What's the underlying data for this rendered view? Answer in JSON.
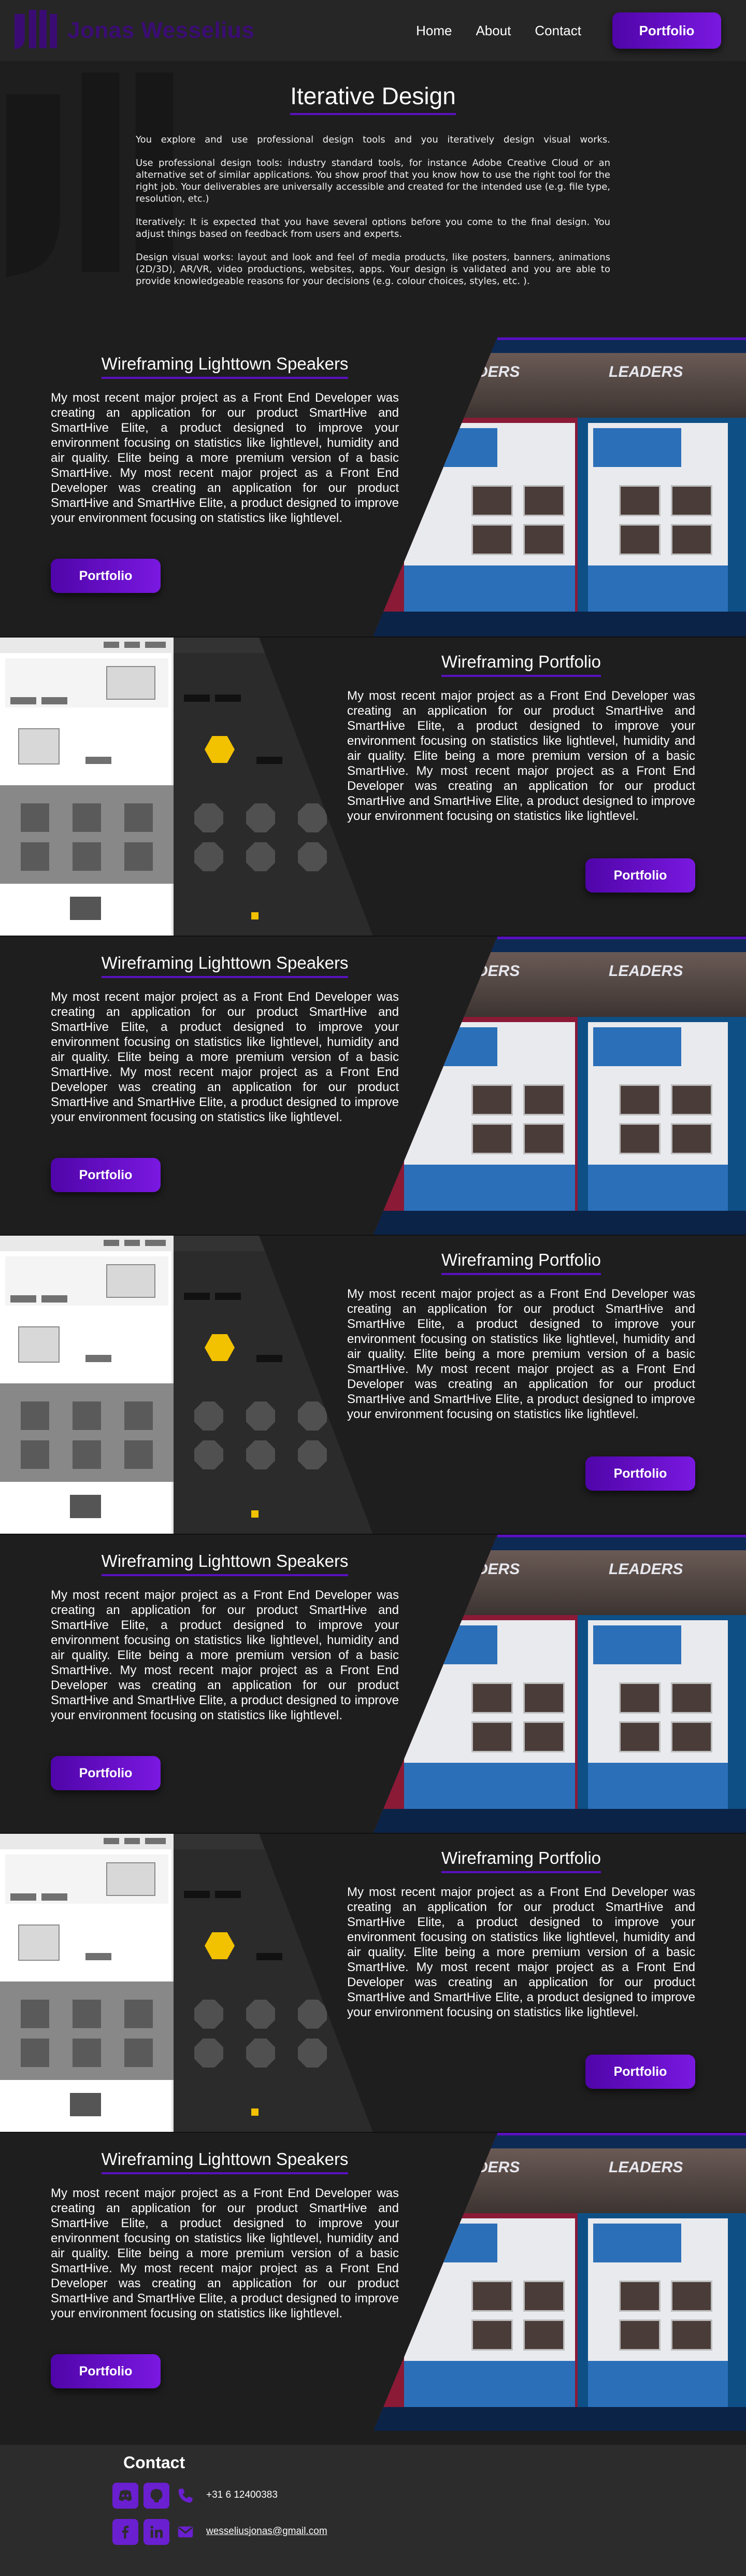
{
  "header": {
    "brand": "Jonas Wesselius",
    "nav": [
      {
        "label": "Home"
      },
      {
        "label": "About"
      },
      {
        "label": "Contact"
      }
    ],
    "cta": "Portfolio"
  },
  "intro": {
    "title": "Iterative Design",
    "paragraphs": [
      "You explore and use professional design tools and you iteratively design visual works.",
      "Use professional design tools: industry standard tools, for instance Adobe Creative Cloud or an alternative set of similar applications. You show proof that you know how to use the right tool for the right job. Your deliverables are universally accessible and created for the intended use (e.g. file type, resolution, etc.)",
      "Iteratively: It is expected that you have several options before you come to the final design. You adjust things based on feedback from users and experts.",
      "Design visual works: layout and look and feel of media products, like posters, banners, animations (2D/3D), AR/VR, video productions, websites, apps. Your design is validated and you are able to provide knowledgeable reasons for your decisions (e.g. colour choices, styles, etc. )."
    ]
  },
  "projects": [
    {
      "title": "Wireframing Lighttown Speakers",
      "body": "My most recent major project as a Front End Developer was creating an application for our product SmartHive and SmartHive Elite, a product designed to improve your environment focusing on statistics like lightlevel, humidity and air quality. Elite being a more premium version of a basic SmartHive. My most recent major project as a Front End Developer was creating an application for our product SmartHive and SmartHive Elite, a product designed to improve your environment focusing on statistics like lightlevel.",
      "button": "Portfolio",
      "mockup_heading": "LEADERS"
    },
    {
      "title": "Wireframing Portfolio",
      "body": "My most recent major project as a Front End Developer was creating an application for our product SmartHive and SmartHive Elite, a product designed to improve your environment focusing on statistics like lightlevel, humidity and air quality. Elite being a more premium version of a basic SmartHive. My most recent major project as a Front End Developer was creating an application for our product SmartHive and SmartHive Elite, a product designed to improve your environment focusing on statistics like lightlevel.",
      "button": "Portfolio"
    },
    {
      "title": "Wireframing Lighttown Speakers",
      "body": "My most recent major project as a Front End Developer was creating an application for our product SmartHive and SmartHive Elite, a product designed to improve your environment focusing on statistics like lightlevel, humidity and air quality. Elite being a more premium version of a basic SmartHive. My most recent major project as a Front End Developer was creating an application for our product SmartHive and SmartHive Elite, a product designed to improve your environment focusing on statistics like lightlevel.",
      "button": "Portfolio",
      "mockup_heading": "LEADERS"
    },
    {
      "title": "Wireframing Portfolio",
      "body": "My most recent major project as a Front End Developer was creating an application for our product SmartHive and SmartHive Elite, a product designed to improve your environment focusing on statistics like lightlevel, humidity and air quality. Elite being a more premium version of a basic SmartHive. My most recent major project as a Front End Developer was creating an application for our product SmartHive and SmartHive Elite, a product designed to improve your environment focusing on statistics like lightlevel.",
      "button": "Portfolio"
    },
    {
      "title": "Wireframing Lighttown Speakers",
      "body": "My most recent major project as a Front End Developer was creating an application for our product SmartHive and SmartHive Elite, a product designed to improve your environment focusing on statistics like lightlevel, humidity and air quality. Elite being a more premium version of a basic SmartHive. My most recent major project as a Front End Developer was creating an application for our product SmartHive and SmartHive Elite, a product designed to improve your environment focusing on statistics like lightlevel.",
      "button": "Portfolio",
      "mockup_heading": "LEADERS"
    },
    {
      "title": "Wireframing Portfolio",
      "body": "My most recent major project as a Front End Developer was creating an application for our product SmartHive and SmartHive Elite, a product designed to improve your environment focusing on statistics like lightlevel, humidity and air quality. Elite being a more premium version of a basic SmartHive. My most recent major project as a Front End Developer was creating an application for our product SmartHive and SmartHive Elite, a product designed to improve your environment focusing on statistics like lightlevel.",
      "button": "Portfolio"
    },
    {
      "title": "Wireframing Lighttown Speakers",
      "body": "My most recent major project as a Front End Developer was creating an application for our product SmartHive and SmartHive Elite, a product designed to improve your environment focusing on statistics like lightlevel, humidity and air quality. Elite being a more premium version of a basic SmartHive. My most recent major project as a Front End Developer was creating an application for our product SmartHive and SmartHive Elite, a product designed to improve your environment focusing on statistics like lightlevel.",
      "button": "Portfolio",
      "mockup_heading": "LEADERS"
    }
  ],
  "footer": {
    "title": "Contact",
    "phone": "+31 6 12400383",
    "email": "wesseliusjonas@gmail.com",
    "icons": [
      "discord-icon",
      "github-icon",
      "phone-icon",
      "facebook-icon",
      "linkedin-icon",
      "mail-icon"
    ]
  },
  "colors": {
    "accent": "#5a10c0",
    "brand": "#3a0c73",
    "background": "#1e1e1e",
    "header_bg": "#262626"
  }
}
